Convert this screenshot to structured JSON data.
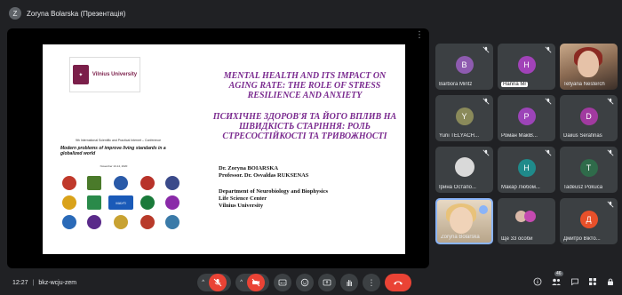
{
  "topbar": {
    "presenter_badge": "Z",
    "presenting_label": "Zoryna Bolarska (Презентація)"
  },
  "slide": {
    "logo_text": "Vilnius University",
    "conf_line": "9th International Scientific and Practical Internet – Conference",
    "conf_title": "Modern problems of improve living standards in a globalized world",
    "conf_date": "November 13-14, 2020",
    "title_en": "MENTAL HEALTH AND ITS IMPACT ON AGING RATE: THE ROLE OF STRESS RESILIENCE AND ANXIETY",
    "title_ua": "ПСИХІЧНЕ ЗДОРОВ'Я ТА ЙОГО ВПЛИВ НА ШВИДКІСТЬ СТАРІННЯ: РОЛЬ СТРЕСОСТІЙКОСТІ ТА ТРИВОЖНОСТІ",
    "author_1": "Dr. Zoryna BOIARSKA",
    "author_2": "Professor. Dr. Osvaldas RUKSENAS",
    "affil_1": "Department of Neurobiology and Biophysics",
    "affil_2": "Life Science Center",
    "affil_3": "Vilnius University",
    "partner_logo_label": "МАУП"
  },
  "participants": [
    {
      "name": "Barbora Mintz",
      "initial": "B",
      "color": "#8e5bb0",
      "kind": "avatar"
    },
    {
      "name": "Hanna Mr",
      "initial": "H",
      "color": "#a142b8",
      "kind": "avatar"
    },
    {
      "name": "Tetyana Nesterch",
      "initial": "",
      "color": "",
      "kind": "photo"
    },
    {
      "name": "Yurii TELYACH...",
      "initial": "Y",
      "color": "#8a8a5a",
      "kind": "avatar"
    },
    {
      "name": "Роман МакіВ...",
      "initial": "Р",
      "color": "#9c44b8",
      "kind": "avatar"
    },
    {
      "name": "Daiius Serafinas",
      "initial": "D",
      "color": "#a13aa0",
      "kind": "avatar"
    },
    {
      "name": "Ірина Остапо...",
      "initial": "",
      "color": "",
      "kind": "emoji"
    },
    {
      "name": "Макар Любом...",
      "initial": "H",
      "color": "#1f8a8a",
      "kind": "avatar"
    },
    {
      "name": "Tadeusz Pokuca",
      "initial": "T",
      "color": "#2f6b4a",
      "kind": "avatar"
    },
    {
      "name": "Zoryna Bolarska",
      "initial": "",
      "color": "",
      "kind": "self"
    },
    {
      "name": "Ще 33 особи",
      "initial": "",
      "color": "",
      "kind": "group"
    },
    {
      "name": "Дмитро Вікто...",
      "initial": "Д",
      "color": "#e8502a",
      "kind": "avatar"
    }
  ],
  "bottombar": {
    "time": "12:27",
    "separator": "|",
    "meeting_code": "bkz-wcju-zem",
    "people_count": "46"
  }
}
